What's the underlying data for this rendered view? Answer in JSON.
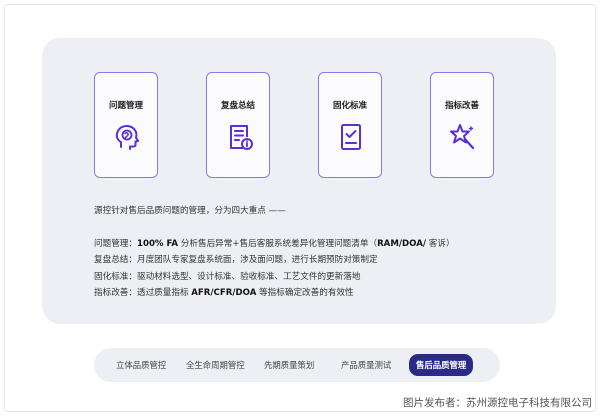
{
  "tiles": [
    {
      "label": "问题管理",
      "icon": "brain-head-icon"
    },
    {
      "label": "复盘总结",
      "icon": "document-info-icon"
    },
    {
      "label": "固化标准",
      "icon": "checklist-icon"
    },
    {
      "label": "指标改善",
      "icon": "magic-star-icon"
    }
  ],
  "intro": "源控针对售后品质问题的管理，分为四大重点 ——",
  "details": [
    {
      "key": "问题管理：",
      "bold": "100% FA",
      "text": " 分析售后异常+售后客服系统差异化管理问题清单（",
      "bold2": "RAM/DOA/",
      "tail": " 客诉）"
    },
    {
      "key": "复盘总结：",
      "text": "月度团队专家复盘系统面，涉及面问题，进行长期预防对策制定"
    },
    {
      "key": "固化标准：",
      "text": "驱动材料选型、设计标准、验收标准、工艺文件的更新落地"
    },
    {
      "key": "指标改善：",
      "text": "透过质量指标 ",
      "bold": "AFR/CFR/DOA",
      "tail": " 等指标确定改善的有效性"
    }
  ],
  "tabs": [
    "立体品质管控",
    "全生命周期管控",
    "先期质量策划",
    "产品质量测试",
    "售后品质管理"
  ],
  "active_tab": "售后品质管理",
  "credit": "图片发布者：苏州源控电子科技有限公司",
  "colors": {
    "accent": "#5b2fd8",
    "tile_border": "#8878e6",
    "active_tab": "#2b2a87"
  }
}
